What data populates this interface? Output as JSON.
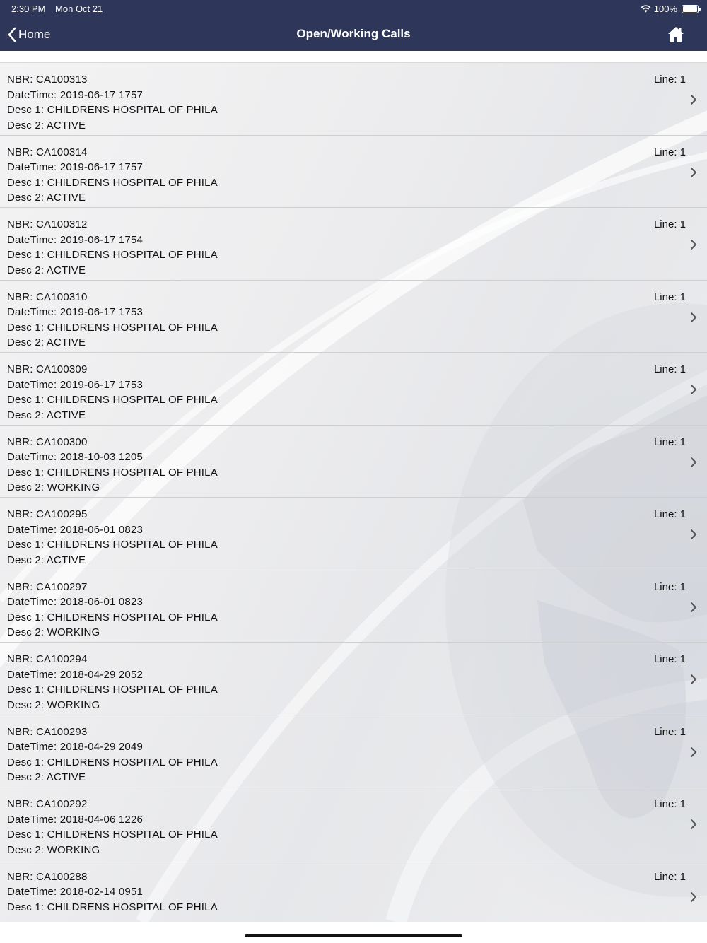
{
  "status_bar": {
    "time": "2:30 PM",
    "date": "Mon Oct 21",
    "battery": "100%"
  },
  "nav": {
    "back_label": "Home",
    "title": "Open/Working Calls",
    "home_icon": "house-icon",
    "colors": {
      "bar": "#2e3759",
      "text": "#ffffff"
    }
  },
  "calls": [
    {
      "nbr": "NBR: CA100313",
      "datetime": "DateTime: 2019-06-17 1757",
      "desc1": "Desc 1: CHILDRENS HOSPITAL OF PHILA",
      "desc2": "Desc 2: ACTIVE",
      "line": "Line: 1"
    },
    {
      "nbr": "NBR: CA100314",
      "datetime": "DateTime: 2019-06-17 1757",
      "desc1": "Desc 1: CHILDRENS HOSPITAL OF PHILA",
      "desc2": "Desc 2: ACTIVE",
      "line": "Line: 1"
    },
    {
      "nbr": "NBR: CA100312",
      "datetime": "DateTime: 2019-06-17 1754",
      "desc1": "Desc 1: CHILDRENS HOSPITAL OF PHILA",
      "desc2": "Desc 2: ACTIVE",
      "line": "Line: 1"
    },
    {
      "nbr": "NBR: CA100310",
      "datetime": "DateTime: 2019-06-17 1753",
      "desc1": "Desc 1: CHILDRENS HOSPITAL OF PHILA",
      "desc2": "Desc 2: ACTIVE",
      "line": "Line: 1"
    },
    {
      "nbr": "NBR: CA100309",
      "datetime": "DateTime: 2019-06-17 1753",
      "desc1": "Desc 1: CHILDRENS HOSPITAL OF PHILA",
      "desc2": "Desc 2: ACTIVE",
      "line": "Line: 1"
    },
    {
      "nbr": "NBR: CA100300",
      "datetime": "DateTime: 2018-10-03 1205",
      "desc1": "Desc 1: CHILDRENS HOSPITAL OF PHILA",
      "desc2": "Desc 2: WORKING",
      "line": "Line: 1"
    },
    {
      "nbr": "NBR: CA100295",
      "datetime": "DateTime: 2018-06-01 0823",
      "desc1": "Desc 1: CHILDRENS HOSPITAL OF PHILA",
      "desc2": "Desc 2: ACTIVE",
      "line": "Line: 1"
    },
    {
      "nbr": "NBR: CA100297",
      "datetime": "DateTime: 2018-06-01 0823",
      "desc1": "Desc 1: CHILDRENS HOSPITAL OF PHILA",
      "desc2": "Desc 2: WORKING",
      "line": "Line: 1"
    },
    {
      "nbr": "NBR: CA100294",
      "datetime": "DateTime: 2018-04-29 2052",
      "desc1": "Desc 1: CHILDRENS HOSPITAL OF PHILA",
      "desc2": "Desc 2: WORKING",
      "line": "Line: 1"
    },
    {
      "nbr": "NBR: CA100293",
      "datetime": "DateTime: 2018-04-29 2049",
      "desc1": "Desc 1: CHILDRENS HOSPITAL OF PHILA",
      "desc2": "Desc 2: ACTIVE",
      "line": "Line: 1"
    },
    {
      "nbr": "NBR: CA100292",
      "datetime": "DateTime: 2018-04-06 1226",
      "desc1": "Desc 1: CHILDRENS HOSPITAL OF PHILA",
      "desc2": "Desc 2: WORKING",
      "line": "Line: 1"
    },
    {
      "nbr": "NBR: CA100288",
      "datetime": "DateTime: 2018-02-14 0951",
      "desc1": "Desc 1: CHILDRENS HOSPITAL OF PHILA",
      "desc2": "",
      "line": "Line: 1"
    }
  ],
  "icons": {
    "row_chevron": "chevron-right-icon",
    "back": "chevron-left-icon",
    "wifi": "wifi-icon",
    "battery": "battery-icon"
  }
}
